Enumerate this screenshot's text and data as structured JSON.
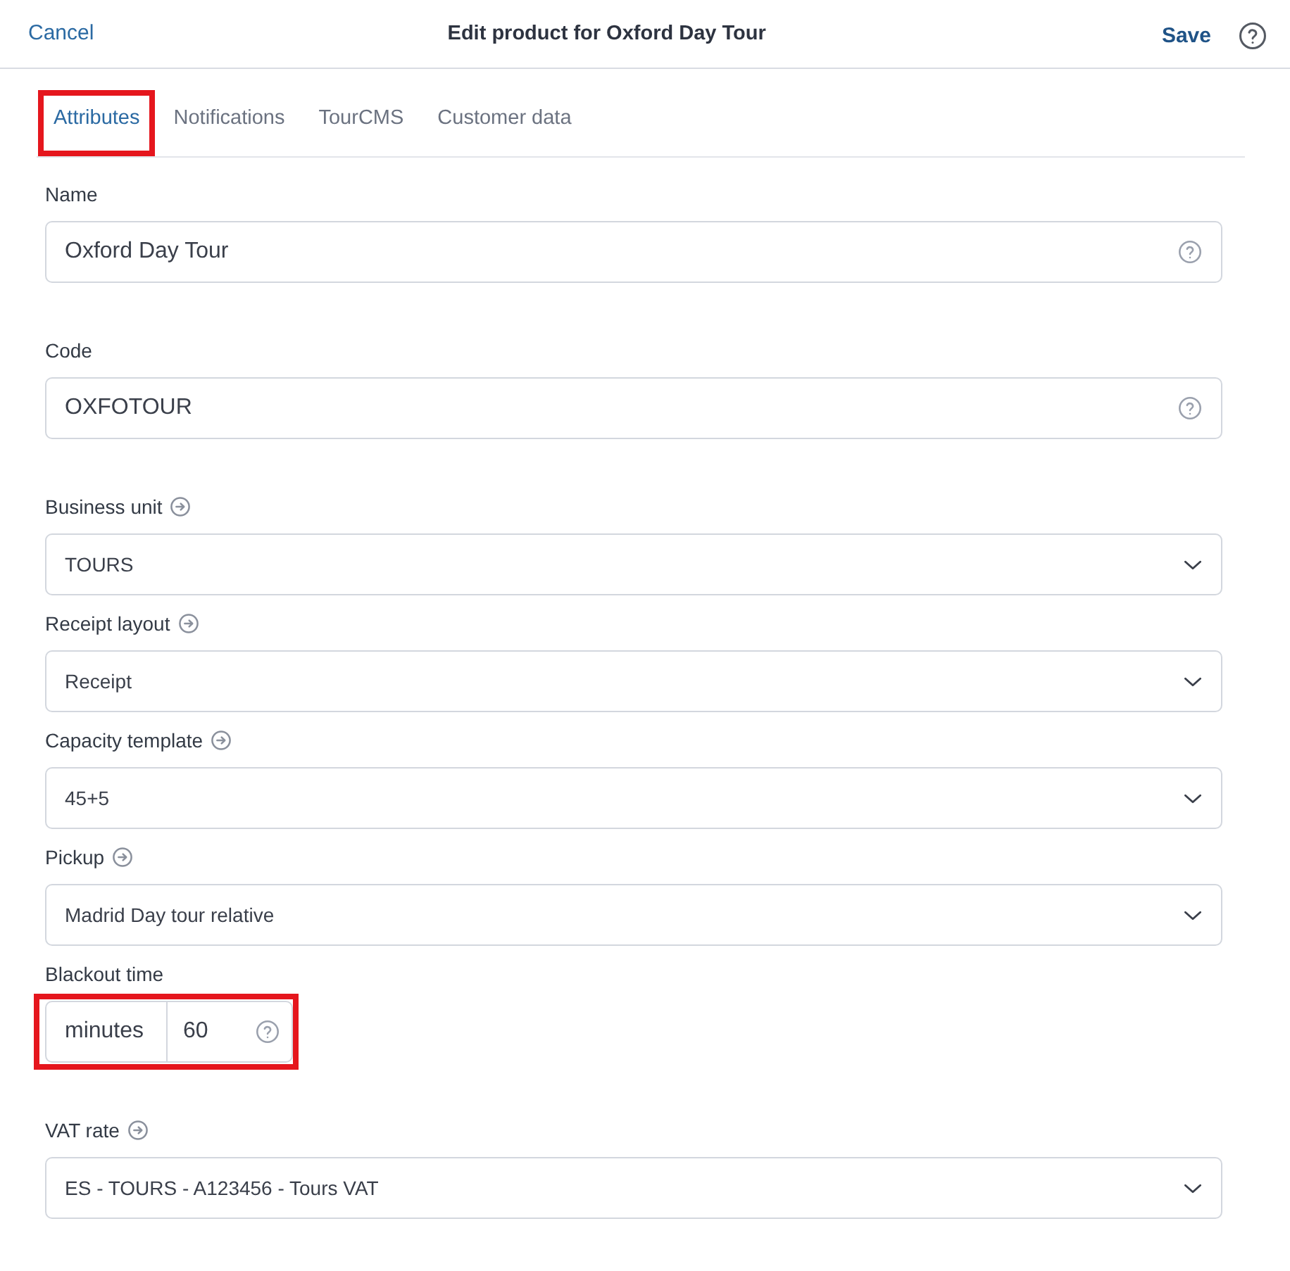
{
  "header": {
    "cancel": "Cancel",
    "title": "Edit product for Oxford Day Tour",
    "save": "Save"
  },
  "tabs": [
    {
      "label": "Attributes",
      "selected": true,
      "highlighted": true
    },
    {
      "label": "Notifications",
      "selected": false,
      "highlighted": false
    },
    {
      "label": "TourCMS",
      "selected": false,
      "highlighted": false
    },
    {
      "label": "Customer data",
      "selected": false,
      "highlighted": false
    }
  ],
  "fields": [
    {
      "kind": "text",
      "label": "Name",
      "value": "Oxford Day Tour",
      "highlighted": false
    },
    {
      "kind": "text",
      "label": "Code",
      "value": "OXFOTOUR",
      "highlighted": false
    },
    {
      "kind": "select",
      "label": "Business unit",
      "value": "TOURS",
      "highlighted": false
    },
    {
      "kind": "select",
      "label": "Receipt layout",
      "value": "Receipt",
      "highlighted": false
    },
    {
      "kind": "select",
      "label": "Capacity template",
      "value": "45+5",
      "highlighted": false
    },
    {
      "kind": "select",
      "label": "Pickup",
      "value": "Madrid Day tour relative",
      "highlighted": false
    },
    {
      "kind": "unit",
      "label": "Blackout time",
      "unit": "minutes",
      "value": "60",
      "highlighted": true
    },
    {
      "kind": "select",
      "label": "VAT rate",
      "value": "ES - TOURS - A123456 - Tours VAT",
      "highlighted": false
    }
  ]
}
